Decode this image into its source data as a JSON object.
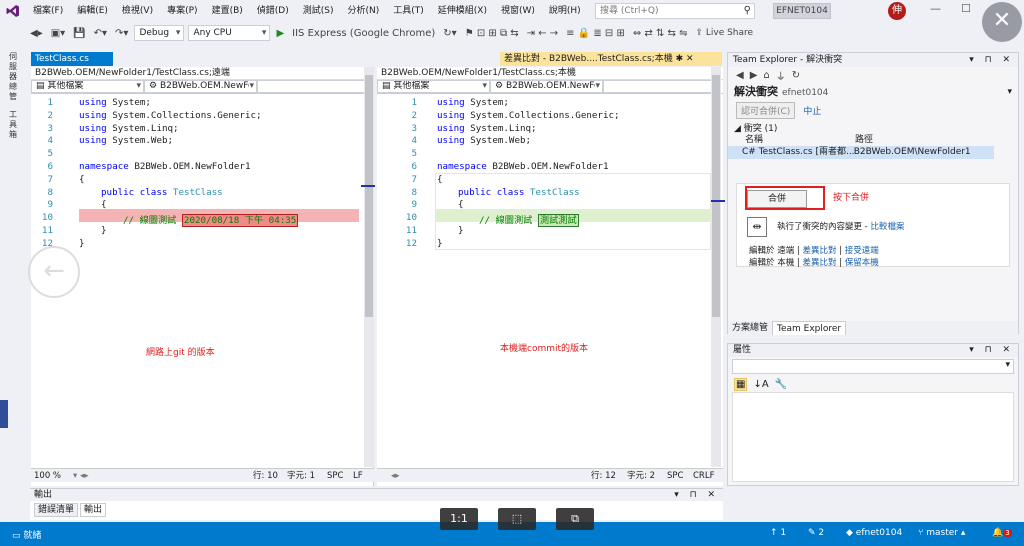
{
  "menubar": {
    "items": [
      "檔案(F)",
      "編輯(E)",
      "檢視(V)",
      "專案(P)",
      "建置(B)",
      "偵錯(D)",
      "測試(S)",
      "分析(N)",
      "工具(T)",
      "延伸模組(X)",
      "視窗(W)",
      "說明(H)"
    ],
    "search_placeholder": "搜尋 (Ctrl+Q)",
    "solution_name": "EFNET0104",
    "avatar_initial": "伸"
  },
  "toolbar": {
    "config": "Debug",
    "platform": "Any CPU",
    "run_label": "IIS Express (Google Chrome)",
    "live_share": "Live Share"
  },
  "sidebar_left": {
    "labels": [
      "伺服器總管",
      "工具箱"
    ]
  },
  "tabs": {
    "left_tab": "TestClass.cs",
    "right_tab": "差異比對 - B2BWeb....TestClass.cs;本機 ✱ ✕"
  },
  "left_pane": {
    "path": "B2BWeb.OEM/NewFolder1/TestClass.cs;遠端",
    "nav_left": "其他檔案",
    "nav_mid": "B2BWeb.OEM.NewFo",
    "lines": [
      "1",
      "2",
      "3",
      "4",
      "5",
      "6",
      "7",
      "8",
      "9",
      "10",
      "11",
      "12"
    ],
    "code": {
      "l1_kw": "using",
      "l1_rest": " System;",
      "l2_kw": "using",
      "l2_rest": " System.Collections.Generic;",
      "l3_kw": "using",
      "l3_rest": " System.Linq;",
      "l4_kw": "using",
      "l4_rest": " System.Web;",
      "l6_kw": "namespace",
      "l6_rest": " B2BWeb.OEM.NewFolder1",
      "l7": "{",
      "l8_kw": "public class",
      "l8_type": " TestClass",
      "l9": "{",
      "l10_comment": "// 線圖測試",
      "l10_highlight": "2020/08/18 下午 04:35",
      "l11": "}",
      "l12": "}"
    },
    "annotation": "網路上git 的版本",
    "status": {
      "zoom": "100 %",
      "line": "行: 10",
      "char": "字元: 1",
      "ws": "SPC",
      "eol": "LF"
    }
  },
  "right_pane": {
    "path": "B2BWeb.OEM/NewFolder1/TestClass.cs;本機",
    "nav_left": "其他檔案",
    "nav_mid": "B2BWeb.OEM.NewFo",
    "lines": [
      "1",
      "2",
      "3",
      "4",
      "5",
      "6",
      "7",
      "8",
      "9",
      "10",
      "11",
      "12"
    ],
    "code": {
      "l1_kw": "using",
      "l1_rest": " System;",
      "l2_kw": "using",
      "l2_rest": " System.Collections.Generic;",
      "l3_kw": "using",
      "l3_rest": " System.Linq;",
      "l4_kw": "using",
      "l4_rest": " System.Web;",
      "l6_kw": "namespace",
      "l6_rest": " B2BWeb.OEM.NewFolder1",
      "l7": "{",
      "l8_kw": "public class",
      "l8_type": " TestClass",
      "l9": "{",
      "l10_comment": "// 線圖測試",
      "l10_highlight": "測試測試",
      "l11": "}",
      "l12": "}"
    },
    "annotation": "本機端commit的版本",
    "status": {
      "line": "行: 12",
      "char": "字元: 2",
      "ws": "SPC",
      "eol": "CRLF"
    }
  },
  "team_explorer": {
    "title": "Team Explorer - 解決衝突",
    "heading": "解決衝突",
    "account": "efnet0104",
    "btn_accept_merge": "認可合併(C)",
    "link_abort": "中止",
    "conflicts_header": "衝突 (1)",
    "col_name": "名稱",
    "col_path": "路徑",
    "row_name": "TestClass.cs [兩者都...",
    "row_path": "B2BWeb.OEM\\NewFolder1",
    "merge_button": "合併",
    "merge_caption": "按下合併",
    "diff_text": "執行了衝突的內容變更 -",
    "diff_link": "比較檔案",
    "line1_pre": "編輯於 遠端",
    "line1_l1": "差異比對",
    "line1_l2": "接受遠端",
    "line2_pre": "編輯於 本機",
    "line2_l1": "差異比對",
    "line2_l2": "保留本機"
  },
  "bottom_tabs": {
    "tab1": "方案總管",
    "tab2": "Team Explorer"
  },
  "properties": {
    "title": "屬性"
  },
  "output": {
    "title": "輸出",
    "tab1": "錯誤清單",
    "tab2": "輸出"
  },
  "zoom_controls": [
    "1:1",
    "⬚",
    "⧉"
  ],
  "statusbar": {
    "ready": "就緒",
    "up": "1",
    "edits": "2",
    "repo": "efnet0104",
    "branch": "master",
    "notif": "3"
  },
  "colors": {
    "accent": "#007acc",
    "removed": "#f6b3b3",
    "added": "#dff0d0",
    "annotation": "#e02020"
  }
}
